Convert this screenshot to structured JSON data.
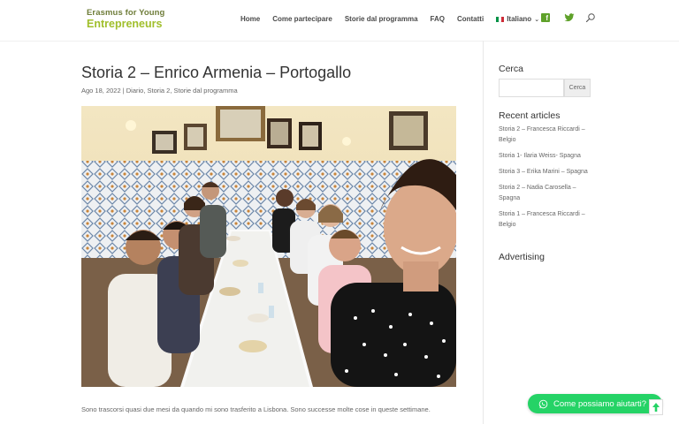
{
  "logo": {
    "line1": "Erasmus for Young",
    "line2": "Entrepreneurs"
  },
  "nav": {
    "items": [
      "Home",
      "Come partecipare",
      "Storie dal programma",
      "FAQ",
      "Contatti"
    ],
    "language": "Italiano"
  },
  "colors": {
    "brand_green": "#a0bf2b",
    "whatsapp_green": "#25d366",
    "social_green": "#5fa12a"
  },
  "icons": [
    "facebook-icon",
    "twitter-icon",
    "search-icon",
    "whatsapp-icon",
    "scroll-top-icon"
  ],
  "article": {
    "title": "Storia 2 – Enrico Armenia – Portogallo",
    "meta": "Ago 18, 2022 | Diario, Storia 2, Storie dal programma",
    "body_start": "Sono trascorsi quasi due mesi da quando mi sono trasferito a Lisbona. Sono successe molte cose in queste settimane."
  },
  "sidebar": {
    "search_title": "Cerca",
    "search_button": "Cerca",
    "search_value": "",
    "recent_title": "Recent articles",
    "recent": [
      "Storia 2 – Francesca Riccardi – Belgio",
      "Storia 1- Ilaria Weiss- Spagna",
      "Storia 3 – Erika Marini – Spagna",
      "Storia 2 – Nadia Carosella – Spagna",
      "Storia 1 – Francesca Riccardi – Belgio"
    ],
    "advertising_title": "Advertising"
  },
  "whatsapp": {
    "label": "Come possiamo aiutarti?"
  }
}
